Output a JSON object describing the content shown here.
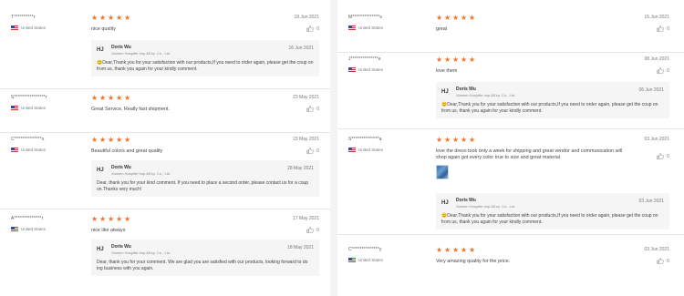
{
  "colors": {
    "star": "#f0722b",
    "flag_red": "#c9342c",
    "flag_blue": "#3a4a8a"
  },
  "left_reviews": [
    {
      "reviewer": "T**********r",
      "country": "United States",
      "date": "18 Jun 2021",
      "text": "nice quality",
      "helpful": "0",
      "reply": {
        "avatar": "HJ",
        "name": "Doris Wu",
        "company": "Xiamen Hospitte Imp.&Exp. Co., Ltd.",
        "date": "16 Jun 2021",
        "text": "😊Dear,Thank you for your satisfaction with our products,If you need to order again, please get the coup on from us, thank you again for your kindly comment."
      }
    },
    {
      "reviewer": "S****************r",
      "country": "United States",
      "date": "23 May 2021",
      "text": "Great Service, Really fast shipment.",
      "helpful": "0"
    },
    {
      "reviewer": "C**************s",
      "country": "United States",
      "date": "23 May 2021",
      "text": "Beautiful colors and great quality",
      "helpful": "0",
      "reply": {
        "avatar": "HJ",
        "name": "Doris Wu",
        "company": "Xiamen Hospitte Imp.&Exp. Co., Ltd.",
        "date": "28 May 2021",
        "text": "Dear, thank you for your kind comment. If you need to place a second order, please contact us for a coup on.Thanks very much!"
      }
    },
    {
      "reviewer": "A**************r",
      "country": "United States",
      "date": "17 May 2021",
      "text": "nice like always",
      "helpful": "0",
      "reply": {
        "avatar": "HJ",
        "name": "Doris Wu",
        "company": "Xiamen Hospitte Imp.&Exp. Co., Ltd.",
        "date": "18 May 2021",
        "text": "Dear, thank you for your comment. We are glad you are satisfied with our products, looking forward to do ing business with you again."
      }
    }
  ],
  "right_reviews": [
    {
      "reviewer": "M**************s",
      "country": "United States",
      "date": "15 Jun 2021",
      "text": "great",
      "helpful": "0"
    },
    {
      "reviewer": "J**************e",
      "country": "United States",
      "date": "08 Jun 2021",
      "text": "love them",
      "helpful": "0",
      "reply": {
        "avatar": "HJ",
        "name": "Doris Wu",
        "company": "Xiamen Hospitte Imp.&Exp. Co., Ltd.",
        "date": "06 Jun 2021",
        "text": "😊Dear,Thank you for your satisfaction with our products,If you need to order again, please get the coup on from us, thank you again for your kindly comment."
      }
    },
    {
      "reviewer": "S**************a",
      "country": "United States",
      "date": "03 Jun 2021",
      "text": "love the dress took only a week for shipping and great vendor and communication will shop again got every color true to size and great material",
      "helpful": "0",
      "reply": {
        "avatar": "HJ",
        "name": "Doris Wu",
        "company": "Xiamen Hospitte Imp.&Exp. Co., Ltd.",
        "date": "03 Jun 2021",
        "text": "😊Dear,Thank you for your satisfaction with our products,If you need to order again, please get the coup on from us, thank you again for your kindly comment."
      }
    },
    {
      "reviewer": "C**************y",
      "country": "United States",
      "date": "03 Jun 2021",
      "text": "Very amazing quality for the price.",
      "helpful": "0"
    }
  ]
}
